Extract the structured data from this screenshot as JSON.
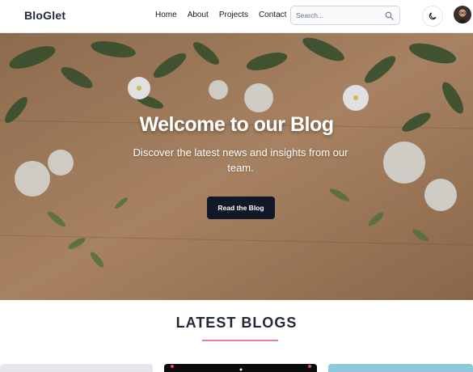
{
  "header": {
    "brand": "BloGlet",
    "nav": [
      "Home",
      "About",
      "Projects",
      "Contact"
    ],
    "search_placeholder": "Search..."
  },
  "hero": {
    "title": "Welcome to our Blog",
    "subtitle": "Discover the latest news and insights from our team.",
    "cta": "Read the Blog"
  },
  "latest": {
    "title": "LATEST BLOGS"
  },
  "colors": {
    "accent_underline": "#e779b0",
    "button_bg": "#111827",
    "hero_wood": "#b58a63"
  },
  "icons": [
    "search-icon",
    "moon-icon",
    "user-avatar"
  ]
}
